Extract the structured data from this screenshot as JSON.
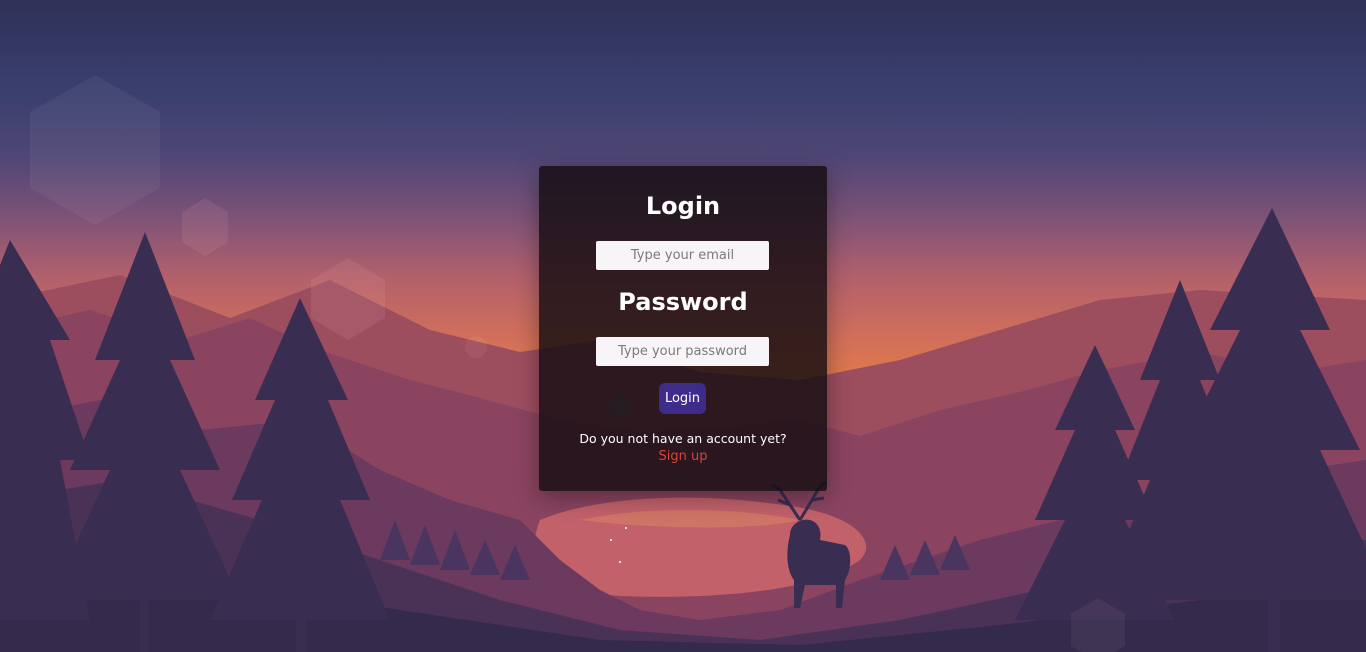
{
  "login_form": {
    "title": "Login",
    "email_placeholder": "Type your email",
    "password_title": "Password",
    "password_placeholder": "Type your password",
    "submit_label": "Login",
    "signup_prompt": "Do you not have an account yet?",
    "signup_link": "Sign up"
  },
  "colors": {
    "submit_button": "#3e2c8a",
    "signup_link": "#d9433a",
    "card_background": "#140c10"
  },
  "background": {
    "scene": "sunset-mountain-lake-with-deer-and-pines"
  }
}
